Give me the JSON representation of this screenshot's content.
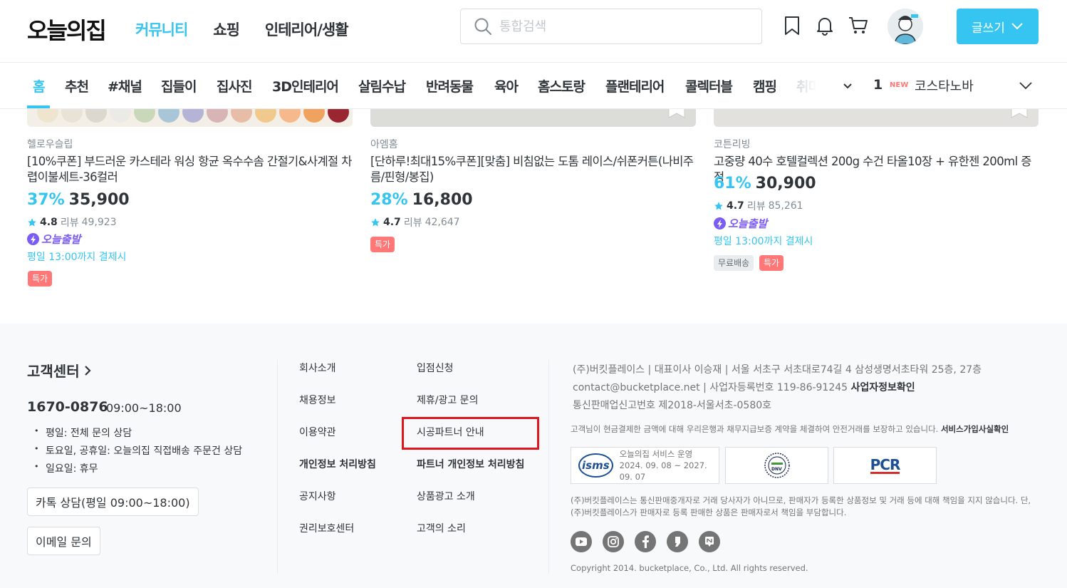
{
  "header": {
    "logo": "오늘의집",
    "nav": [
      "커뮤니티",
      "쇼핑",
      "인테리어/생활"
    ],
    "search_placeholder": "통합검색",
    "write_label": "글쓰기"
  },
  "categories": [
    "홈",
    "추천",
    "#채널",
    "집들이",
    "집사진",
    "3D인테리어",
    "살림수납",
    "반려동물",
    "육아",
    "홈스토랑",
    "플랜테리어",
    "콜렉터블",
    "캠핑",
    "취미"
  ],
  "ranking": {
    "rank": "1",
    "new": "NEW",
    "keyword": "코스타노바"
  },
  "products": [
    {
      "brand": "헬로우슬립",
      "name": "[10%쿠폰] 부드러운 카스테라 워싱 항균 옥수수솜 간절기&사계절 차렵이불세트-36컬러",
      "discount": "37%",
      "price": "35,900",
      "rating": "4.8",
      "review_label": "리뷰",
      "reviews": "49,923",
      "today_label": "오늘출발",
      "deadline": "평일 13:00까지 결제시",
      "badges": [
        "특가"
      ]
    },
    {
      "brand": "아엠홈",
      "name": "[단하루!최대15%쿠폰][맞춤] 비침없는 도톰 레이스/쉬폰커튼(나비주름/핀형/봉집)",
      "discount": "28%",
      "price": "16,800",
      "rating": "4.7",
      "review_label": "리뷰",
      "reviews": "42,647",
      "badges": [
        "특가"
      ]
    },
    {
      "brand": "코튼리빙",
      "name": "고중량 40수 호텔컬렉션 200g 수건 타올10장 + 유한젠 200ml 증정",
      "discount": "61%",
      "price": "30,900",
      "rating": "4.7",
      "review_label": "리뷰",
      "reviews": "85,261",
      "today_label": "오늘출발",
      "deadline": "평일 13:00까지 결제시",
      "badges": [
        "무료배송",
        "특가"
      ]
    }
  ],
  "footer": {
    "cs_title": "고객센터",
    "phone": "1670-0876",
    "hours": "09:00~18:00",
    "cs_notes": [
      "평일: 전체 문의 상담",
      "토요일, 공휴일: 오늘의집 직접배송 주문건 상담",
      "일요일: 휴무"
    ],
    "kakao_btn": "카톡 상담(평일 09:00~18:00)",
    "email_btn": "이메일 문의",
    "links_col1": [
      "회사소개",
      "채용정보",
      "이용약관",
      "개인정보 처리방침",
      "공지사항",
      "권리보호센터"
    ],
    "links_col2": [
      "입점신청",
      "제휴/광고 문의",
      "시공파트너 안내",
      "파트너 개인정보 처리방침",
      "상품광고 소개",
      "고객의 소리"
    ],
    "company_line1": "(주)버킷플레이스 | 대표이사 이승재 | 서울 서초구 서초대로74길 4 삼성생명서초타워 25층, 27층",
    "company_email": "contact@bucketplace.net",
    "company_biz": "| 사업자등록번호 119-86-91245",
    "company_biz_link": "사업자정보확인",
    "company_line3": "통신판매업신고번호 제2018-서울서초-0580호",
    "escrow_note": "고객님이 현금결제한 금액에 대해 우리은행과 채무지급보증 계약을 체결하여 안전거래를 보장하고 있습니다.",
    "escrow_link": "서비스가입사실확인",
    "cert1_logo": "isms",
    "cert1_title": "오늘의집 서비스 운영",
    "cert1_period": "2024. 09. 08 ~ 2027. 09. 07",
    "cert2_logo": "DNV",
    "cert3_logo": "PCR",
    "disclaimer": "(주)버킷플레이스는 통신판매중개자로 거래 당사자가 아니므로, 판매자가 등록한 상품정보 및 거래 등에 대해 책임을 지지 않습니다. 단, (주)버킷플레이스가 판매자로 등록 판매한 상품은 판매자로서 책임을 부담합니다.",
    "copyright": "Copyright 2014. bucketplace, Co., Ltd. All rights reserved."
  },
  "colors": {
    "accent": "#35c5f0",
    "today": "#7b5cf5",
    "sale": "#ff7777",
    "highlight": "#e0161e"
  },
  "icons": [
    "search-icon",
    "bookmark-icon",
    "bell-icon",
    "cart-icon",
    "chevron-down-icon",
    "chevron-right-icon",
    "star-icon",
    "bolt-icon",
    "youtube-icon",
    "instagram-icon",
    "facebook-icon",
    "kakao-story-icon",
    "naver-post-icon"
  ]
}
